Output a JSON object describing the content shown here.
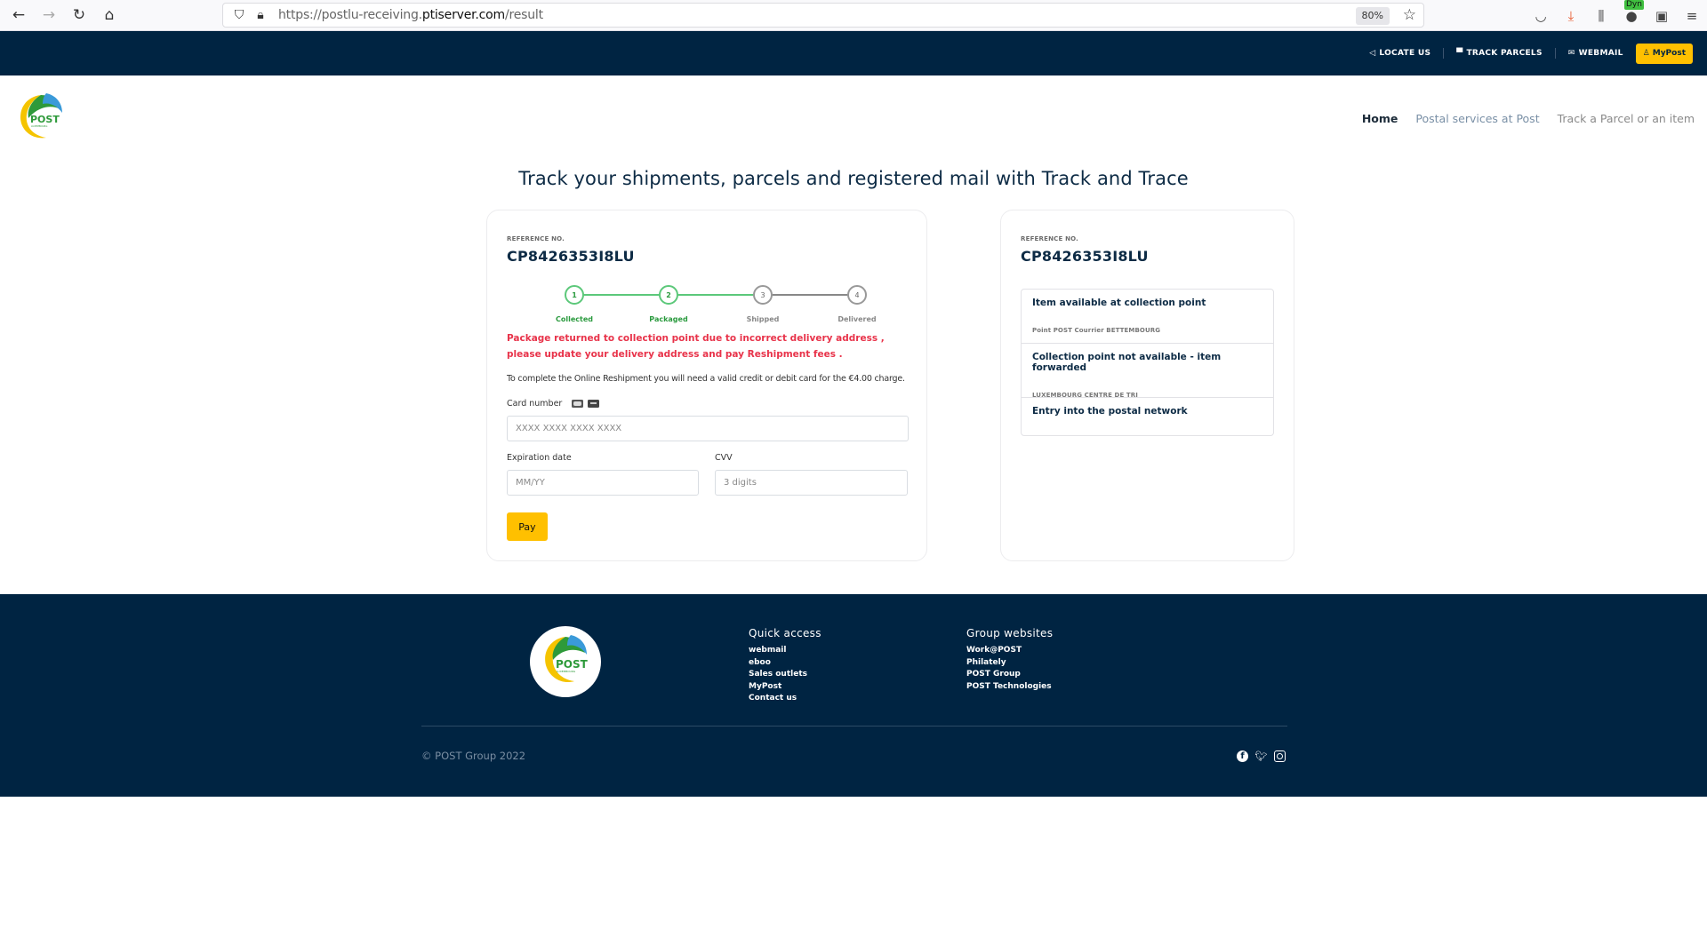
{
  "browser": {
    "url_prefix": "https://postlu-receiving.",
    "url_domain": "ptiserver.com",
    "url_path": "/result",
    "zoom": "80%",
    "extension_badge": "Dyn"
  },
  "topbar": {
    "locate_us": "LOCATE US",
    "track_parcels": "TRACK PARCELS",
    "webmail": "WEBMAIL",
    "mypost": "MyPost"
  },
  "header": {
    "logo_text": "POST",
    "logo_subtext": "LUXEMBOURG",
    "nav": [
      {
        "label": "Home"
      },
      {
        "label": "Postal services at Post"
      },
      {
        "label": "Track a Parcel or an item"
      }
    ]
  },
  "page_title": "Track your shipments, parcels and registered mail with Track and Trace",
  "left_card": {
    "ref_label": "REFERENCE NO.",
    "ref_value": "CP8426353I8LU",
    "steps": [
      {
        "num": "1",
        "label": "Collected",
        "done": true
      },
      {
        "num": "2",
        "label": "Packaged",
        "done": true
      },
      {
        "num": "3",
        "label": "Shipped",
        "done": false
      },
      {
        "num": "4",
        "label": "Delivered",
        "done": false
      }
    ],
    "alert": "Package returned to collection point due to incorrect delivery address , please update your delivery address and pay Reshipment fees .",
    "info": "To complete the Online Reshipment you will need a valid credit or debit card for the €4.00 charge.",
    "card_number_label": "Card number",
    "card_number_placeholder": "XXXX XXXX XXXX XXXX",
    "expiry_label": "Expiration date",
    "expiry_placeholder": "MM/YY",
    "cvv_label": "CVV",
    "cvv_placeholder": "3 digits",
    "pay_label": "Pay"
  },
  "right_card": {
    "ref_label": "REFERENCE NO.",
    "ref_value": "CP8426353I8LU",
    "events": [
      {
        "title": "Item available at collection point",
        "location": "Point POST Courrier BETTEMBOURG"
      },
      {
        "title": "Collection point not available - item forwarded",
        "location": "LUXEMBOURG CENTRE DE TRI"
      },
      {
        "title": "Entry into the postal network",
        "location": ""
      }
    ]
  },
  "footer": {
    "quick_access_title": "Quick access",
    "quick_access": [
      "webmail",
      "eboo",
      "Sales outlets",
      "MyPost",
      "Contact us"
    ],
    "group_title": "Group websites",
    "group_links": [
      "Work@POST",
      "Philately",
      "POST Group",
      "POST Technologies"
    ],
    "copyright": "© POST Group 2022"
  },
  "colors": {
    "navy": "#002442",
    "accent_yellow": "#ffc000",
    "step_green": "#5cc87a",
    "alert_red": "#e8334a"
  }
}
